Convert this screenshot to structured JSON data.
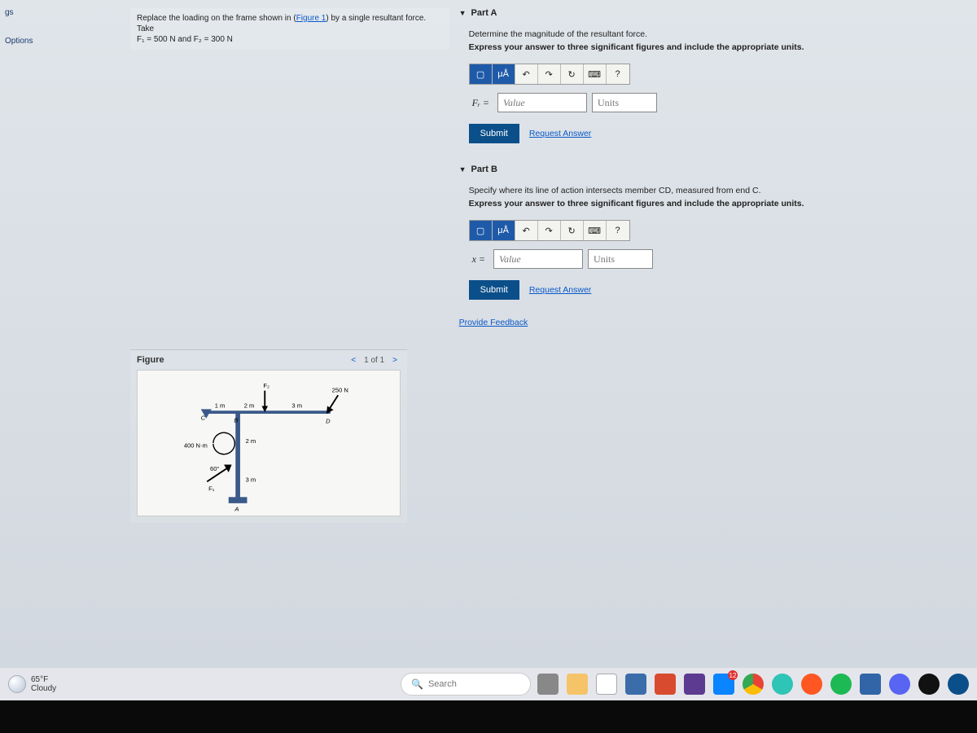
{
  "nav": {
    "item0": "gs",
    "item1": "Options"
  },
  "problem": {
    "text_pre": "Replace the loading on the frame shown in (",
    "link": "Figure 1",
    "text_post": ") by a single resultant force. Take",
    "line2": "F₁ = 500 N and F₂ = 300 N"
  },
  "figure": {
    "title": "Figure",
    "pager": "1 of 1",
    "labels": {
      "f2": "F₂",
      "n250": "250 N",
      "m1": "1 m",
      "m2a": "2 m",
      "m3a": "3 m",
      "B": "B",
      "D": "D",
      "m2b": "2 m",
      "nm400": "400 N·m",
      "deg60": "60°",
      "m3b": "3 m",
      "F1": "F₁",
      "A": "A",
      "C": "C"
    }
  },
  "partA": {
    "title": "Part A",
    "instruction": "Determine the magnitude of the resultant force.",
    "express": "Express your answer to three significant figures and include the appropriate units.",
    "lhs": "Fᵣ =",
    "value_ph": "Value",
    "units_ph": "Units",
    "submit": "Submit",
    "request": "Request Answer"
  },
  "partB": {
    "title": "Part B",
    "instruction": "Specify where its line of action intersects member CD, measured from end C.",
    "express": "Express your answer to three significant figures and include the appropriate units.",
    "lhs": "x =",
    "value_ph": "Value",
    "units_ph": "Units",
    "submit": "Submit",
    "request": "Request Answer"
  },
  "toolbar": {
    "tmpl": "▢",
    "mu": "μÅ",
    "undo": "↶",
    "redo": "↷",
    "reset": "↻",
    "kbd": "⌨",
    "help": "?"
  },
  "feedback": "Provide Feedback",
  "weather": {
    "temp": "65°F",
    "cond": "Cloudy"
  },
  "search": {
    "placeholder": "Search"
  }
}
